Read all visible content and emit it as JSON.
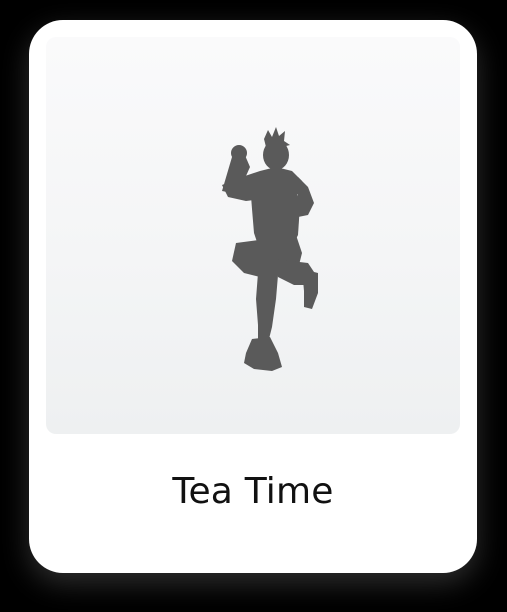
{
  "card": {
    "title": "Tea Time",
    "icon": "dancer-silhouette-icon"
  },
  "colors": {
    "page_background": "#000000",
    "card_background": "#ffffff",
    "silhouette": "#5a5a5a",
    "title_text": "#111111"
  }
}
